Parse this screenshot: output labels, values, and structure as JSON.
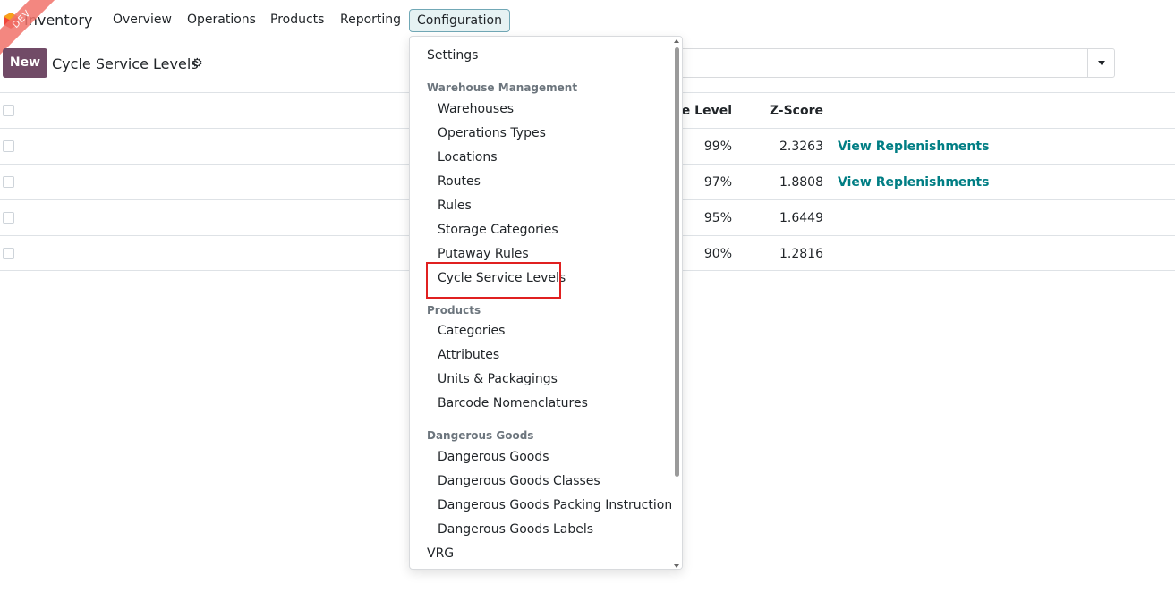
{
  "navbar": {
    "ribbon": "DEV",
    "app_name": "Inventory",
    "menu": [
      "Overview",
      "Operations",
      "Products",
      "Reporting",
      "Configuration"
    ]
  },
  "control_panel": {
    "new_label": "New",
    "title": "Cycle Service Levels",
    "gear_icon": "gear-icon"
  },
  "list": {
    "headers": {
      "level": "ice Level",
      "zscore": "Z-Score"
    },
    "rows": [
      {
        "level": "99%",
        "zscore": "2.3263",
        "action": "View Replenishments"
      },
      {
        "level": "97%",
        "zscore": "1.8808",
        "action": "View Replenishments"
      },
      {
        "level": "95%",
        "zscore": "1.6449",
        "action": ""
      },
      {
        "level": "90%",
        "zscore": "1.2816",
        "action": ""
      }
    ]
  },
  "dropdown": {
    "settings": "Settings",
    "sections": {
      "warehouse": "Warehouse Management",
      "products": "Products",
      "dangerous": "Dangerous Goods"
    },
    "warehouse_items": [
      "Warehouses",
      "Operations Types",
      "Locations",
      "Routes",
      "Rules",
      "Storage Categories",
      "Putaway Rules",
      "Cycle Service Levels"
    ],
    "product_items": [
      "Categories",
      "Attributes",
      "Units & Packagings",
      "Barcode Nomenclatures"
    ],
    "dangerous_items": [
      "Dangerous Goods",
      "Dangerous Goods Classes",
      "Dangerous Goods Packing Instructions",
      "Dangerous Goods Labels"
    ],
    "vrg": "VRG"
  },
  "colors": {
    "brand": "#714b67",
    "link": "#017e84",
    "highlight": "#e02020",
    "active_menu_bg": "#e6f2f3"
  }
}
